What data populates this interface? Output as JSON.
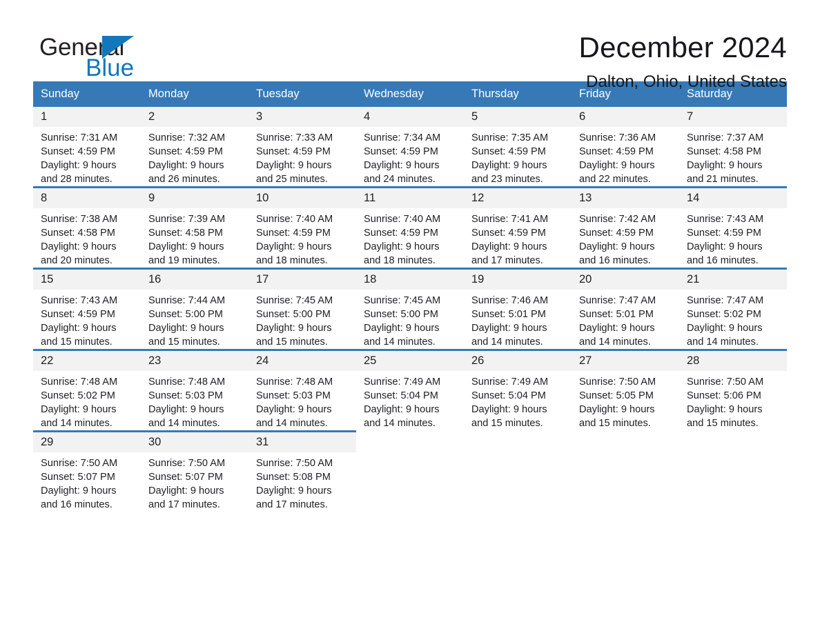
{
  "brand": {
    "word_one": "General",
    "word_two": "Blue",
    "triangle_icon": "brand-triangle-icon",
    "accent_color": "#1277bc"
  },
  "header": {
    "title": "December 2024",
    "subtitle": "Dalton, Ohio, United States"
  },
  "theme": {
    "header_bg": "#3679b6",
    "daynum_bg": "#f2f2f2",
    "text": "#202124"
  },
  "calendar": {
    "weekday_headers": [
      "Sunday",
      "Monday",
      "Tuesday",
      "Wednesday",
      "Thursday",
      "Friday",
      "Saturday"
    ],
    "weeks": [
      [
        {
          "day": "1",
          "sunrise": "Sunrise: 7:31 AM",
          "sunset": "Sunset: 4:59 PM",
          "daylight_line1": "Daylight: 9 hours",
          "daylight_line2": "and 28 minutes."
        },
        {
          "day": "2",
          "sunrise": "Sunrise: 7:32 AM",
          "sunset": "Sunset: 4:59 PM",
          "daylight_line1": "Daylight: 9 hours",
          "daylight_line2": "and 26 minutes."
        },
        {
          "day": "3",
          "sunrise": "Sunrise: 7:33 AM",
          "sunset": "Sunset: 4:59 PM",
          "daylight_line1": "Daylight: 9 hours",
          "daylight_line2": "and 25 minutes."
        },
        {
          "day": "4",
          "sunrise": "Sunrise: 7:34 AM",
          "sunset": "Sunset: 4:59 PM",
          "daylight_line1": "Daylight: 9 hours",
          "daylight_line2": "and 24 minutes."
        },
        {
          "day": "5",
          "sunrise": "Sunrise: 7:35 AM",
          "sunset": "Sunset: 4:59 PM",
          "daylight_line1": "Daylight: 9 hours",
          "daylight_line2": "and 23 minutes."
        },
        {
          "day": "6",
          "sunrise": "Sunrise: 7:36 AM",
          "sunset": "Sunset: 4:59 PM",
          "daylight_line1": "Daylight: 9 hours",
          "daylight_line2": "and 22 minutes."
        },
        {
          "day": "7",
          "sunrise": "Sunrise: 7:37 AM",
          "sunset": "Sunset: 4:58 PM",
          "daylight_line1": "Daylight: 9 hours",
          "daylight_line2": "and 21 minutes."
        }
      ],
      [
        {
          "day": "8",
          "sunrise": "Sunrise: 7:38 AM",
          "sunset": "Sunset: 4:58 PM",
          "daylight_line1": "Daylight: 9 hours",
          "daylight_line2": "and 20 minutes."
        },
        {
          "day": "9",
          "sunrise": "Sunrise: 7:39 AM",
          "sunset": "Sunset: 4:58 PM",
          "daylight_line1": "Daylight: 9 hours",
          "daylight_line2": "and 19 minutes."
        },
        {
          "day": "10",
          "sunrise": "Sunrise: 7:40 AM",
          "sunset": "Sunset: 4:59 PM",
          "daylight_line1": "Daylight: 9 hours",
          "daylight_line2": "and 18 minutes."
        },
        {
          "day": "11",
          "sunrise": "Sunrise: 7:40 AM",
          "sunset": "Sunset: 4:59 PM",
          "daylight_line1": "Daylight: 9 hours",
          "daylight_line2": "and 18 minutes."
        },
        {
          "day": "12",
          "sunrise": "Sunrise: 7:41 AM",
          "sunset": "Sunset: 4:59 PM",
          "daylight_line1": "Daylight: 9 hours",
          "daylight_line2": "and 17 minutes."
        },
        {
          "day": "13",
          "sunrise": "Sunrise: 7:42 AM",
          "sunset": "Sunset: 4:59 PM",
          "daylight_line1": "Daylight: 9 hours",
          "daylight_line2": "and 16 minutes."
        },
        {
          "day": "14",
          "sunrise": "Sunrise: 7:43 AM",
          "sunset": "Sunset: 4:59 PM",
          "daylight_line1": "Daylight: 9 hours",
          "daylight_line2": "and 16 minutes."
        }
      ],
      [
        {
          "day": "15",
          "sunrise": "Sunrise: 7:43 AM",
          "sunset": "Sunset: 4:59 PM",
          "daylight_line1": "Daylight: 9 hours",
          "daylight_line2": "and 15 minutes."
        },
        {
          "day": "16",
          "sunrise": "Sunrise: 7:44 AM",
          "sunset": "Sunset: 5:00 PM",
          "daylight_line1": "Daylight: 9 hours",
          "daylight_line2": "and 15 minutes."
        },
        {
          "day": "17",
          "sunrise": "Sunrise: 7:45 AM",
          "sunset": "Sunset: 5:00 PM",
          "daylight_line1": "Daylight: 9 hours",
          "daylight_line2": "and 15 minutes."
        },
        {
          "day": "18",
          "sunrise": "Sunrise: 7:45 AM",
          "sunset": "Sunset: 5:00 PM",
          "daylight_line1": "Daylight: 9 hours",
          "daylight_line2": "and 14 minutes."
        },
        {
          "day": "19",
          "sunrise": "Sunrise: 7:46 AM",
          "sunset": "Sunset: 5:01 PM",
          "daylight_line1": "Daylight: 9 hours",
          "daylight_line2": "and 14 minutes."
        },
        {
          "day": "20",
          "sunrise": "Sunrise: 7:47 AM",
          "sunset": "Sunset: 5:01 PM",
          "daylight_line1": "Daylight: 9 hours",
          "daylight_line2": "and 14 minutes."
        },
        {
          "day": "21",
          "sunrise": "Sunrise: 7:47 AM",
          "sunset": "Sunset: 5:02 PM",
          "daylight_line1": "Daylight: 9 hours",
          "daylight_line2": "and 14 minutes."
        }
      ],
      [
        {
          "day": "22",
          "sunrise": "Sunrise: 7:48 AM",
          "sunset": "Sunset: 5:02 PM",
          "daylight_line1": "Daylight: 9 hours",
          "daylight_line2": "and 14 minutes."
        },
        {
          "day": "23",
          "sunrise": "Sunrise: 7:48 AM",
          "sunset": "Sunset: 5:03 PM",
          "daylight_line1": "Daylight: 9 hours",
          "daylight_line2": "and 14 minutes."
        },
        {
          "day": "24",
          "sunrise": "Sunrise: 7:48 AM",
          "sunset": "Sunset: 5:03 PM",
          "daylight_line1": "Daylight: 9 hours",
          "daylight_line2": "and 14 minutes."
        },
        {
          "day": "25",
          "sunrise": "Sunrise: 7:49 AM",
          "sunset": "Sunset: 5:04 PM",
          "daylight_line1": "Daylight: 9 hours",
          "daylight_line2": "and 14 minutes."
        },
        {
          "day": "26",
          "sunrise": "Sunrise: 7:49 AM",
          "sunset": "Sunset: 5:04 PM",
          "daylight_line1": "Daylight: 9 hours",
          "daylight_line2": "and 15 minutes."
        },
        {
          "day": "27",
          "sunrise": "Sunrise: 7:50 AM",
          "sunset": "Sunset: 5:05 PM",
          "daylight_line1": "Daylight: 9 hours",
          "daylight_line2": "and 15 minutes."
        },
        {
          "day": "28",
          "sunrise": "Sunrise: 7:50 AM",
          "sunset": "Sunset: 5:06 PM",
          "daylight_line1": "Daylight: 9 hours",
          "daylight_line2": "and 15 minutes."
        }
      ],
      [
        {
          "day": "29",
          "sunrise": "Sunrise: 7:50 AM",
          "sunset": "Sunset: 5:07 PM",
          "daylight_line1": "Daylight: 9 hours",
          "daylight_line2": "and 16 minutes."
        },
        {
          "day": "30",
          "sunrise": "Sunrise: 7:50 AM",
          "sunset": "Sunset: 5:07 PM",
          "daylight_line1": "Daylight: 9 hours",
          "daylight_line2": "and 17 minutes."
        },
        {
          "day": "31",
          "sunrise": "Sunrise: 7:50 AM",
          "sunset": "Sunset: 5:08 PM",
          "daylight_line1": "Daylight: 9 hours",
          "daylight_line2": "and 17 minutes."
        },
        {
          "day": "",
          "sunrise": "",
          "sunset": "",
          "daylight_line1": "",
          "daylight_line2": ""
        },
        {
          "day": "",
          "sunrise": "",
          "sunset": "",
          "daylight_line1": "",
          "daylight_line2": ""
        },
        {
          "day": "",
          "sunrise": "",
          "sunset": "",
          "daylight_line1": "",
          "daylight_line2": ""
        },
        {
          "day": "",
          "sunrise": "",
          "sunset": "",
          "daylight_line1": "",
          "daylight_line2": ""
        }
      ]
    ]
  }
}
